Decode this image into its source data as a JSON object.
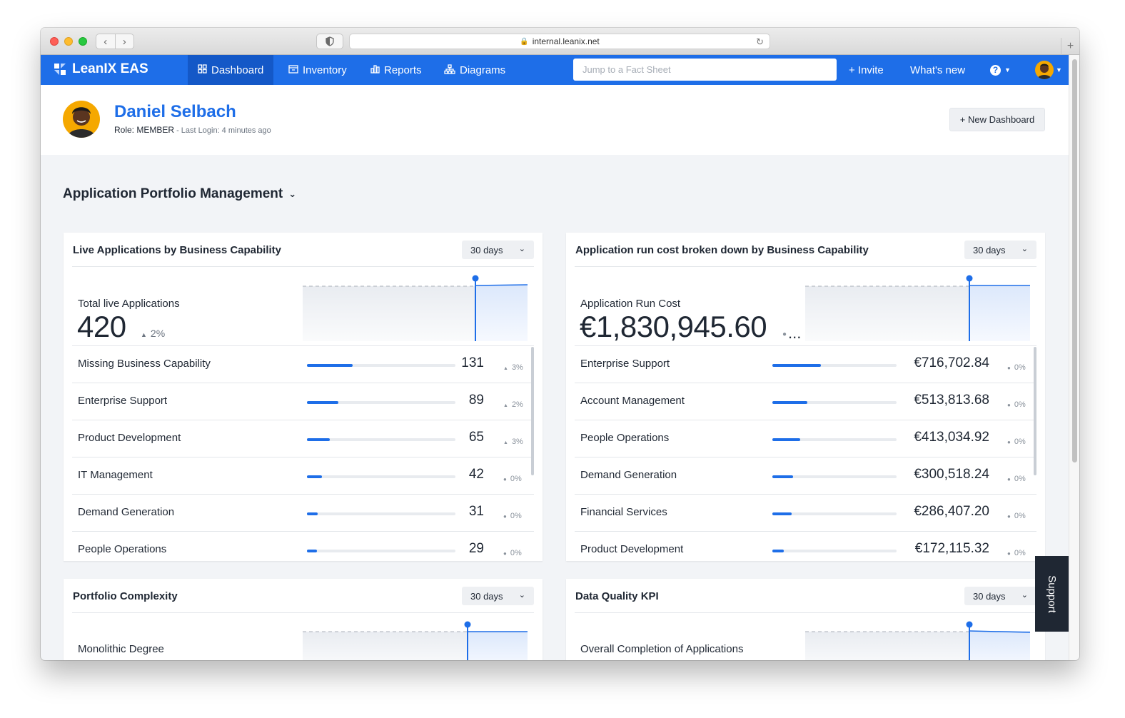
{
  "browser": {
    "url": "internal.leanix.net"
  },
  "nav": {
    "brand": "LeanIX EAS",
    "items": [
      {
        "label": "Dashboard",
        "icon": "grid-icon",
        "active": true
      },
      {
        "label": "Inventory",
        "icon": "inventory-icon",
        "active": false
      },
      {
        "label": "Reports",
        "icon": "bar-chart-icon",
        "active": false
      },
      {
        "label": "Diagrams",
        "icon": "diagram-icon",
        "active": false
      }
    ],
    "search_placeholder": "Jump to a Fact Sheet",
    "invite": "+ Invite",
    "whats_new": "What's new",
    "help": "?"
  },
  "user": {
    "name": "Daniel Selbach",
    "role": "Role: MEMBER",
    "last_login": " - Last Login: 4 minutes ago",
    "new_dashboard": "+ New Dashboard"
  },
  "dashboard": {
    "title": "Application Portfolio Management"
  },
  "cards": {
    "live_apps": {
      "title": "Live Applications by Business Capability",
      "period": "30 days",
      "kpi_label": "Total live Applications",
      "kpi_value": "420",
      "kpi_delta": "2%",
      "rows": [
        {
          "label": "Missing Business Capability",
          "value": "131",
          "delta": "3%",
          "trend": "up",
          "fraction": 0.31
        },
        {
          "label": "Enterprise Support",
          "value": "89",
          "delta": "2%",
          "trend": "up",
          "fraction": 0.21
        },
        {
          "label": "Product Development",
          "value": "65",
          "delta": "3%",
          "trend": "up",
          "fraction": 0.155
        },
        {
          "label": "IT Management",
          "value": "42",
          "delta": "0%",
          "trend": "flat",
          "fraction": 0.1
        },
        {
          "label": "Demand Generation",
          "value": "31",
          "delta": "0%",
          "trend": "flat",
          "fraction": 0.074
        },
        {
          "label": "People Operations",
          "value": "29",
          "delta": "0%",
          "trend": "flat",
          "fraction": 0.069
        }
      ]
    },
    "run_cost": {
      "title": "Application run cost broken down by Business Capability",
      "period": "30 days",
      "kpi_label": "Application Run Cost",
      "kpi_value": "€1,830,945.60",
      "kpi_delta": "...",
      "rows": [
        {
          "label": "Enterprise Support",
          "value": "€716,702.84",
          "delta": "0%",
          "trend": "flat",
          "fraction": 0.39
        },
        {
          "label": "Account Management",
          "value": "€513,813.68",
          "delta": "0%",
          "trend": "flat",
          "fraction": 0.28
        },
        {
          "label": "People Operations",
          "value": "€413,034.92",
          "delta": "0%",
          "trend": "flat",
          "fraction": 0.225
        },
        {
          "label": "Demand Generation",
          "value": "€300,518.24",
          "delta": "0%",
          "trend": "flat",
          "fraction": 0.164
        },
        {
          "label": "Financial Services",
          "value": "€286,407.20",
          "delta": "0%",
          "trend": "flat",
          "fraction": 0.156
        },
        {
          "label": "Product Development",
          "value": "€172,115.32",
          "delta": "0%",
          "trend": "flat",
          "fraction": 0.094
        }
      ]
    },
    "complexity": {
      "title": "Portfolio Complexity",
      "period": "30 days",
      "kpi_label": "Monolithic Degree"
    },
    "data_quality": {
      "title": "Data Quality KPI",
      "period": "30 days",
      "kpi_label": "Overall Completion of Applications"
    }
  },
  "support": "Support"
}
